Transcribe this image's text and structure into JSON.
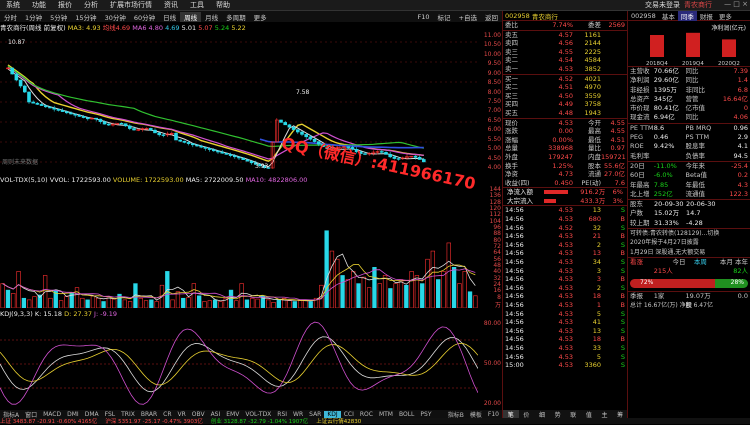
{
  "menu": {
    "items": [
      "系统",
      "功能",
      "报价",
      "分析",
      "扩展市场行情",
      "资讯",
      "工具",
      "帮助"
    ],
    "login": "交易未登录",
    "stock_title": "青农商行",
    "controls": "— □ ×"
  },
  "toolbar": {
    "items": [
      "分时",
      "1分钟",
      "5分钟",
      "15分钟",
      "30分钟",
      "60分钟",
      "日线",
      "周线",
      "月线",
      "多周期",
      "更多"
    ],
    "active": "周线",
    "right": [
      "F10",
      "标记",
      "+自选",
      "返回"
    ]
  },
  "chart_head": {
    "name": "青农商行(周线 前复权)",
    "ma_label": "MA3: 4.93",
    "ma1": "均线4.69",
    "ma2": "MA6 4.80",
    "ma3": "4.69",
    "ma4": "5.01",
    "ma5": "5.07",
    "ma6": "5.24",
    "ma7": "5.22",
    "left_label": "10.87",
    "watermark": "周则未来数据"
  },
  "price_axis": [
    "11.00",
    "10.50",
    "10.00",
    "9.50",
    "9.00",
    "8.50",
    "8.00",
    "7.50",
    "7.00",
    "6.50",
    "6.00",
    "5.50",
    "5.00",
    "4.50",
    "4.00"
  ],
  "kline_labels": {
    "high": "7.58",
    "low": "3.93"
  },
  "vol_head": {
    "name": "VOL-TDX(5,10)",
    "vvol": "VVOL: 1722593.00",
    "volume": "VOLUME: 1722593.00",
    "ma5": "MA5: 2722009.50",
    "ma10": "MA10: 4822806.00"
  },
  "vol_axis": [
    "144",
    "136",
    "128",
    "120",
    "112",
    "104",
    "96",
    "88",
    "80",
    "72",
    "64",
    "56",
    "48",
    "40",
    "32",
    "24",
    "16",
    "8",
    "万"
  ],
  "vol_bars": [
    30,
    22,
    18,
    45,
    12,
    10,
    14,
    16,
    40,
    12,
    22,
    9,
    14,
    18,
    25,
    12,
    10,
    15,
    12,
    8,
    14,
    11,
    17,
    10,
    8,
    30,
    12,
    9,
    10,
    8,
    28,
    45,
    10,
    20,
    12,
    13,
    30,
    15,
    8,
    9,
    10,
    8,
    12,
    22,
    9,
    30,
    10,
    12,
    11,
    15,
    10,
    7,
    10,
    12,
    9,
    8,
    9,
    10,
    8,
    12,
    28,
    95,
    70,
    60,
    40,
    35,
    45,
    30,
    38,
    25,
    50,
    30,
    40,
    24,
    30,
    35,
    28,
    45,
    40,
    30,
    60,
    70,
    35,
    45,
    80,
    50,
    30,
    45,
    20,
    15
  ],
  "kdj_head": {
    "name": "KDJ(9,3,3)",
    "k": "K: 15.18",
    "d": "D: 27.37",
    "j": "J: -9.19"
  },
  "kdj_axis": [
    "80.00",
    "50.00",
    "20.00"
  ],
  "indicators": [
    "指标A",
    "窗口",
    "MACD",
    "DMI",
    "DMA",
    "FSL",
    "TRIX",
    "BRAR",
    "CR",
    "VR",
    "OBV",
    "ASI",
    "EMV",
    "VOL-TDX",
    "RSI",
    "WR",
    "SAR",
    "KDJ",
    "CCI",
    "ROC",
    "MTM",
    "BOLL",
    "PSY"
  ],
  "indicator_active": "KDJ",
  "indicator_right": [
    "指标B",
    "模板",
    "F10"
  ],
  "overlay": "QQ（微信）:411966170",
  "quote": {
    "code": "002958",
    "name": "青农商行",
    "weibi": "7.74%",
    "weicha": "2569",
    "sells": [
      [
        "卖五",
        "4.57",
        "1161"
      ],
      [
        "卖四",
        "4.56",
        "2144"
      ],
      [
        "卖三",
        "4.55",
        "2225"
      ],
      [
        "卖二",
        "4.54",
        "4584"
      ],
      [
        "卖一",
        "4.53",
        "3852"
      ]
    ],
    "buys": [
      [
        "买一",
        "4.52",
        "4021"
      ],
      [
        "买二",
        "4.51",
        "4970"
      ],
      [
        "买三",
        "4.50",
        "3559"
      ],
      [
        "买四",
        "4.49",
        "3758"
      ],
      [
        "买五",
        "4.48",
        "1943"
      ]
    ],
    "stats": [
      [
        "现价",
        "4.53",
        "今开",
        "4.55"
      ],
      [
        "涨跌",
        "0.00",
        "最高",
        "4.55"
      ],
      [
        "涨幅",
        "0.00%",
        "最低",
        "4.51"
      ],
      [
        "总量",
        "338968",
        "量比",
        "0.97"
      ],
      [
        "外盘",
        "179247",
        "内盘",
        "159721"
      ],
      [
        "换手",
        "1.25%",
        "股本",
        "55.6亿"
      ],
      [
        "净资",
        "4.73",
        "流通",
        "27.0亿"
      ],
      [
        "收益(四)",
        "0.450",
        "PE(动)",
        "7.6"
      ]
    ],
    "flow": [
      [
        "净流入额",
        "916.2万",
        "6%"
      ],
      [
        "大宗流入",
        "433.3万",
        "3%"
      ]
    ],
    "ticks": [
      [
        "14:56",
        "4.53",
        "13",
        "S"
      ],
      [
        "14:56",
        "4.53",
        "680",
        "B"
      ],
      [
        "14:56",
        "4.52",
        "32",
        "S"
      ],
      [
        "14:56",
        "4.53",
        "21",
        "B"
      ],
      [
        "14:56",
        "4.53",
        "2",
        "S"
      ],
      [
        "14:56",
        "4.53",
        "13",
        "B"
      ],
      [
        "14:56",
        "4.53",
        "34",
        "S"
      ],
      [
        "14:56",
        "4.53",
        "3",
        "S"
      ],
      [
        "14:56",
        "4.53",
        "3",
        "B"
      ],
      [
        "14:56",
        "4.53",
        "2",
        "S"
      ],
      [
        "14:56",
        "4.53",
        "18",
        "B"
      ],
      [
        "14:56",
        "4.53",
        "1",
        "B"
      ],
      [
        "14:56",
        "4.53",
        "5",
        "S"
      ],
      [
        "14:56",
        "4.53",
        "41",
        "S"
      ],
      [
        "14:56",
        "4.53",
        "13",
        "S"
      ],
      [
        "14:56",
        "4.53",
        "18",
        "B"
      ],
      [
        "14:56",
        "4.53",
        "33",
        "S"
      ],
      [
        "14:56",
        "4.53",
        "5",
        "S"
      ],
      [
        "15:00",
        "4.53",
        "3360",
        "S"
      ]
    ],
    "tabs": [
      "笔",
      "价",
      "细",
      "势",
      "联",
      "值",
      "主",
      "筹"
    ]
  },
  "right": {
    "tabs": [
      "002958",
      "基本",
      "同季",
      "财报",
      "更多"
    ],
    "chart_caption": "净利润(亿元)",
    "bars": [
      {
        "label": "2018Q4",
        "v": 1
      },
      {
        "label": "2019Q4",
        "v": 1.1
      },
      {
        "label": "2020Q2",
        "v": 0.8
      }
    ],
    "rows1": [
      [
        "主营收",
        "70.66亿",
        "同比",
        "7.39"
      ],
      [
        "净利润",
        "29.60亿",
        "同比",
        "1.4"
      ],
      [
        "非经损",
        "1395万",
        "非同比",
        "6.8"
      ],
      [
        "总资产",
        "345亿",
        "营管",
        "16.64亿"
      ],
      [
        "市价现",
        "80.41亿",
        "亿市值",
        "0"
      ],
      [
        "现金流",
        "6.94亿",
        "同比",
        "4.06"
      ]
    ],
    "rows2": [
      [
        "PE TTM",
        "8.6",
        "PB MRQ",
        "0.96"
      ],
      [
        "PEG",
        "0.46",
        "PS TTM",
        "2.9"
      ],
      [
        "ROE",
        "9.42%",
        "股息率",
        "4.1"
      ],
      [
        "毛利率",
        "",
        "负债率",
        "94.5"
      ]
    ],
    "rows3": [
      [
        "20日",
        "-11.0%",
        "今年来",
        "-25.4"
      ],
      [
        "60日",
        "-6.0%",
        "Beta值",
        "0.2"
      ],
      [
        "年最高",
        "7.85",
        "年最低",
        "4.3"
      ],
      [
        "北上增",
        "252亿",
        "流通值",
        "122.3"
      ]
    ],
    "rows4": [
      [
        "股东",
        "20-09-30",
        "20-06-30"
      ],
      [
        "户数",
        "15.02万",
        "14.7"
      ],
      [
        "较上期",
        "31.33%",
        "-4.28"
      ]
    ],
    "news": [
      "可转债:青农转债(128129)...切换",
      "2020年报于4月27日披露",
      "1月29日 深股通,无大额交易"
    ],
    "sentiment": {
      "title": "看涨",
      "today": "今日",
      "week": "本周",
      "month": "本月",
      "year": "本年",
      "bull": "215人",
      "bull_pct": "72%",
      "bear": "82人",
      "bear_pct": "28%"
    },
    "footer": [
      "季报",
      "1家",
      "19.07万股",
      "0.0"
    ],
    "footer2": "总计 16.67亿(万) 净额  6.47亿"
  },
  "status": {
    "sh": "上证 3483.87 -20.91 -0.60% 4165亿",
    "hs": "沪深 5351.97 -25.17 -0.47% 3903亿",
    "cy": "创业 3128.87 -32.79 -1.04% 1907亿",
    "cloud": "上证云行情42830",
    "ext": "扩展平 关联股价"
  }
}
